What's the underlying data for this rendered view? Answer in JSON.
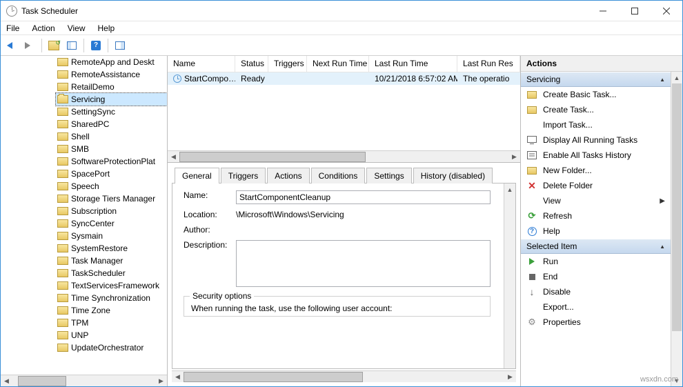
{
  "app": {
    "title": "Task Scheduler"
  },
  "menubar": [
    "File",
    "Action",
    "View",
    "Help"
  ],
  "tree": {
    "items": [
      {
        "label": "RemoteApp and Deskt"
      },
      {
        "label": "RemoteAssistance"
      },
      {
        "label": "RetailDemo"
      },
      {
        "label": "Servicing",
        "selected": true,
        "open": true
      },
      {
        "label": "SettingSync"
      },
      {
        "label": "SharedPC"
      },
      {
        "label": "Shell"
      },
      {
        "label": "SMB"
      },
      {
        "label": "SoftwareProtectionPlat"
      },
      {
        "label": "SpacePort"
      },
      {
        "label": "Speech"
      },
      {
        "label": "Storage Tiers Manager"
      },
      {
        "label": "Subscription"
      },
      {
        "label": "SyncCenter"
      },
      {
        "label": "Sysmain"
      },
      {
        "label": "SystemRestore"
      },
      {
        "label": "Task Manager"
      },
      {
        "label": "TaskScheduler"
      },
      {
        "label": "TextServicesFramework"
      },
      {
        "label": "Time Synchronization"
      },
      {
        "label": "Time Zone"
      },
      {
        "label": "TPM"
      },
      {
        "label": "UNP"
      },
      {
        "label": "UpdateOrchestrator"
      }
    ]
  },
  "tasklist": {
    "headers": [
      "Name",
      "Status",
      "Triggers",
      "Next Run Time",
      "Last Run Time",
      "Last Run Res"
    ],
    "row": {
      "name": "StartCompo…",
      "status": "Ready",
      "triggers": "",
      "next": "",
      "last": "10/21/2018 6:57:02 AM",
      "result": "The operatio"
    }
  },
  "tabs": [
    "General",
    "Triggers",
    "Actions",
    "Conditions",
    "Settings",
    "History (disabled)"
  ],
  "general": {
    "labels": {
      "name": "Name:",
      "location": "Location:",
      "author": "Author:",
      "description": "Description:"
    },
    "name": "StartComponentCleanup",
    "location": "\\Microsoft\\Windows\\Servicing",
    "author": "",
    "description": "",
    "sec_legend": "Security options",
    "sec_text": "When running the task, use the following user account:"
  },
  "actions": {
    "header": "Actions",
    "section1": "Servicing",
    "items1": [
      {
        "icon": "wizard",
        "label": "Create Basic Task..."
      },
      {
        "icon": "wizard",
        "label": "Create Task..."
      },
      {
        "icon": "blank",
        "label": "Import Task..."
      },
      {
        "icon": "display",
        "label": "Display All Running Tasks"
      },
      {
        "icon": "enable",
        "label": "Enable All Tasks History"
      },
      {
        "icon": "folder",
        "label": "New Folder..."
      },
      {
        "icon": "xred",
        "label": "Delete Folder"
      },
      {
        "icon": "blank",
        "label": "View",
        "sub": true
      },
      {
        "icon": "refresh",
        "label": "Refresh"
      },
      {
        "icon": "help",
        "label": "Help"
      }
    ],
    "section2": "Selected Item",
    "items2": [
      {
        "icon": "play",
        "label": "Run"
      },
      {
        "icon": "stop",
        "label": "End"
      },
      {
        "icon": "disable",
        "label": "Disable"
      },
      {
        "icon": "blank",
        "label": "Export..."
      },
      {
        "icon": "gear",
        "label": "Properties"
      }
    ]
  },
  "watermark": "wsxdn.com"
}
